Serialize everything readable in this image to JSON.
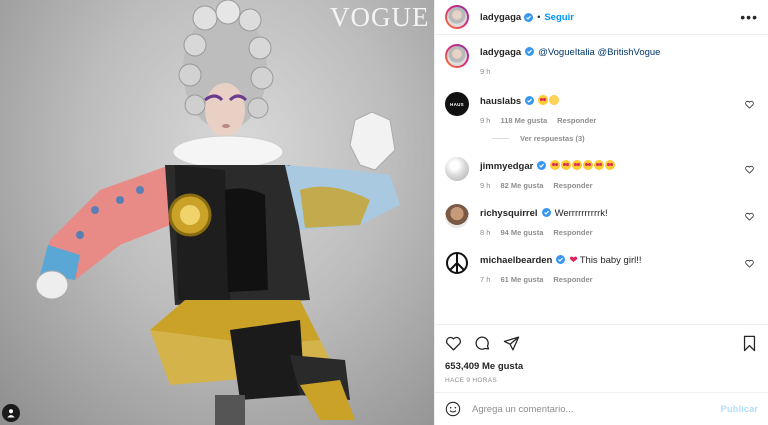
{
  "photo": {
    "watermark": "VOGUE"
  },
  "header": {
    "username": "ladygaga",
    "follow_label": "Seguir",
    "dot": "•",
    "more_label": "•••"
  },
  "caption": {
    "username": "ladygaga",
    "mentions": "@VogueItalia @BritishVogue",
    "time": "9 h"
  },
  "comments": [
    {
      "username": "hauslabs",
      "text": "",
      "time": "9 h",
      "likes": "118 Me gusta",
      "reply": "Responder",
      "view_replies": "Ver respuestas (3)",
      "avatar_text": "HAUS"
    },
    {
      "username": "jimmyedgar",
      "text": "",
      "time": "9 h",
      "likes": "82 Me gusta",
      "reply": "Responder"
    },
    {
      "username": "richysquirrel",
      "text": "Werrrrrrrrrrk!",
      "time": "8 h",
      "likes": "94 Me gusta",
      "reply": "Responder"
    },
    {
      "username": "michaelbearden",
      "text": "This baby girl!!",
      "time": "7 h",
      "likes": "61 Me gusta",
      "reply": "Responder",
      "heart": "❤"
    }
  ],
  "actions": {
    "likes_total": "653,409 Me gusta",
    "time_ago": "HACE 9 HORAS"
  },
  "add_comment": {
    "placeholder": "Agrega un comentario...",
    "publish_label": "Publicar"
  },
  "colors": {
    "accent": "#0095f6",
    "verified": "#3897f0",
    "muted": "#8e8e8e"
  }
}
